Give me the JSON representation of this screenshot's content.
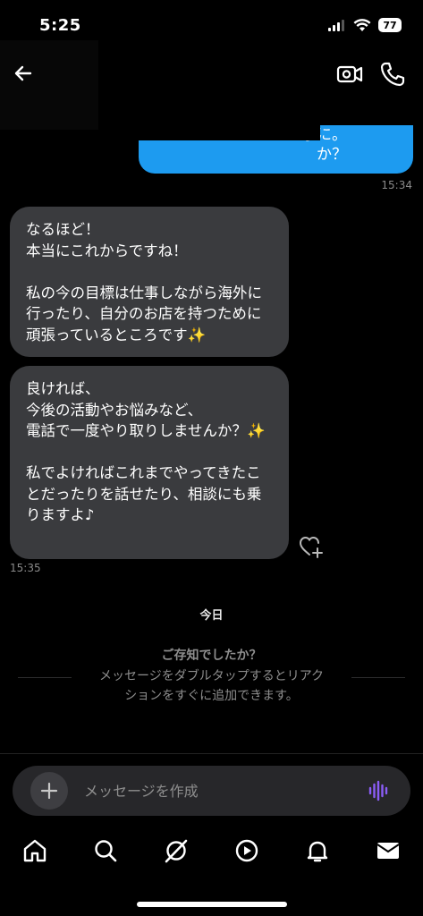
{
  "status_bar": {
    "time": "5:25",
    "battery": "77"
  },
  "header": {
    "back_icon": "arrow-left-icon",
    "video_icon": "video-camera-icon",
    "phone_icon": "phone-icon"
  },
  "conversation": {
    "outgoing_partial": {
      "text": "ハ事に。\nか？",
      "time": "15:34",
      "color": "#1d9bf0"
    },
    "incoming": [
      {
        "text": "なるほど！\n本当にこれからですね！\n\n私の今の目標は仕事しながら海外に行ったり、自分のお店を持つために頑張っているところです✨"
      },
      {
        "text": "良ければ、\n今後の活動やお悩みなど、\n電話で一度やり取りしませんか？✨\n\n私でよければこれまでやってきたことだったりを話せたり、相談にも乗りますよ♪"
      }
    ],
    "incoming_time": "15:35",
    "date_divider": "今日",
    "tip_title": "ご存知でしたか？",
    "tip_body": "メッセージをダブルタップするとリアク\nションをすぐに追加できます。"
  },
  "composer": {
    "placeholder": "メッセージを作成",
    "add_icon": "plus-icon",
    "voice_icon": "voice-waveform-icon"
  },
  "bottom_nav": {
    "items": [
      "home-icon",
      "search-icon",
      "grok-icon",
      "video-play-icon",
      "notifications-bell-icon",
      "messages-envelope-icon"
    ]
  }
}
